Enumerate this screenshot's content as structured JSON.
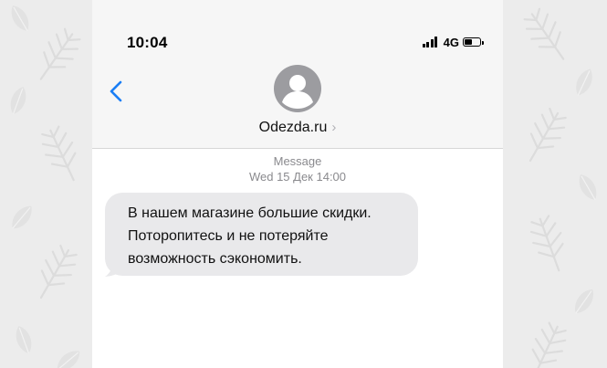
{
  "status_bar": {
    "time": "10:04",
    "network": "4G",
    "signal_bars": 4,
    "battery_level": 0.5
  },
  "header": {
    "back_icon": "chevron-left-icon",
    "avatar_icon": "person-avatar-icon",
    "contact_name": "Odezda.ru",
    "contact_chevron": "›"
  },
  "conversation": {
    "message_type": "Message",
    "timestamp": "Wed 15 Дек 14:00",
    "messages": [
      {
        "direction": "incoming",
        "lines": [
          "В нашем магазине большие скидки.",
          "Поторопитесь и не потеряйте",
          "возможность сэкономить."
        ]
      }
    ]
  },
  "colors": {
    "background": "#ececec",
    "header_bg": "#f6f6f6",
    "accent": "#1a7ef5",
    "bubble_incoming": "#e9e9eb",
    "meta_text": "#8a8a8e",
    "avatar": "#9c9ca0"
  }
}
